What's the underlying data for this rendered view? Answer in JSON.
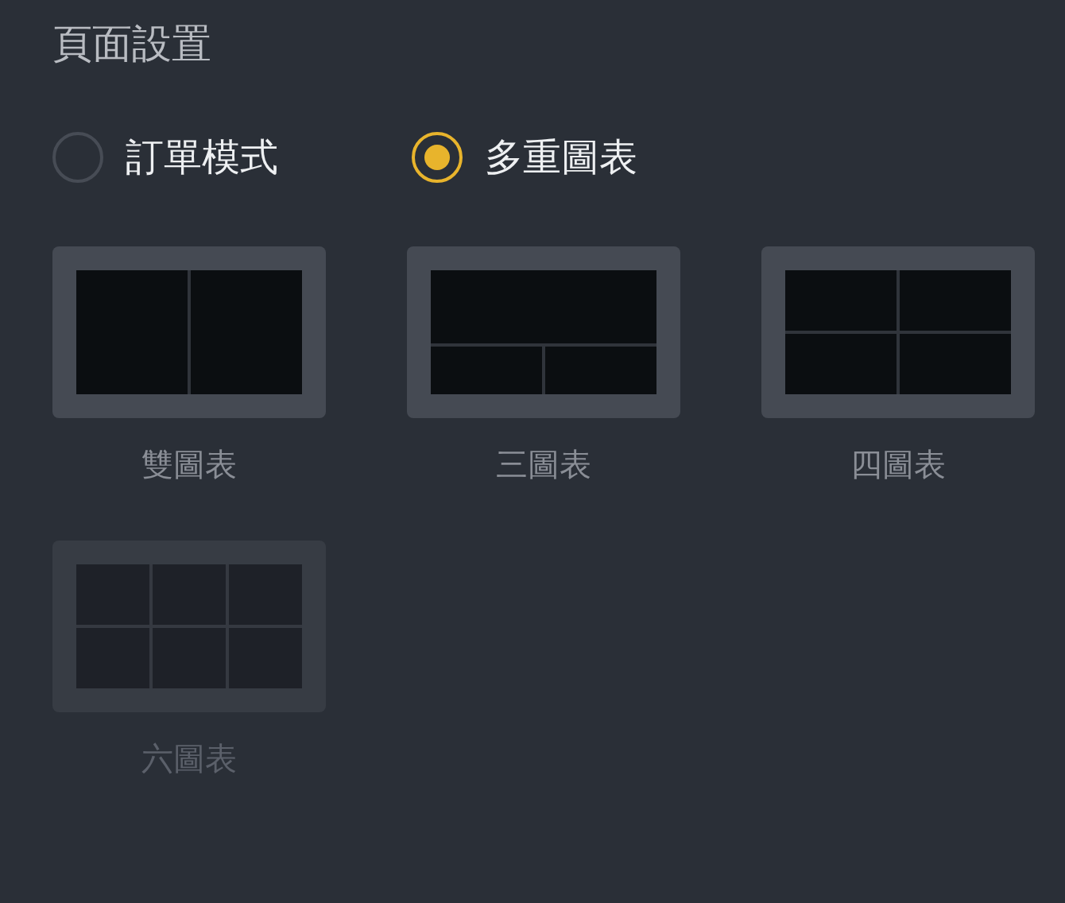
{
  "title": "頁面設置",
  "modes": [
    {
      "label": "訂單模式",
      "selected": false
    },
    {
      "label": "多重圖表",
      "selected": true
    }
  ],
  "layouts": [
    {
      "kind": "two",
      "label": "雙圖表",
      "disabled": false
    },
    {
      "kind": "three",
      "label": "三圖表",
      "disabled": false
    },
    {
      "kind": "four",
      "label": "四圖表",
      "disabled": false
    },
    {
      "kind": "six",
      "label": "六圖表",
      "disabled": true
    }
  ]
}
